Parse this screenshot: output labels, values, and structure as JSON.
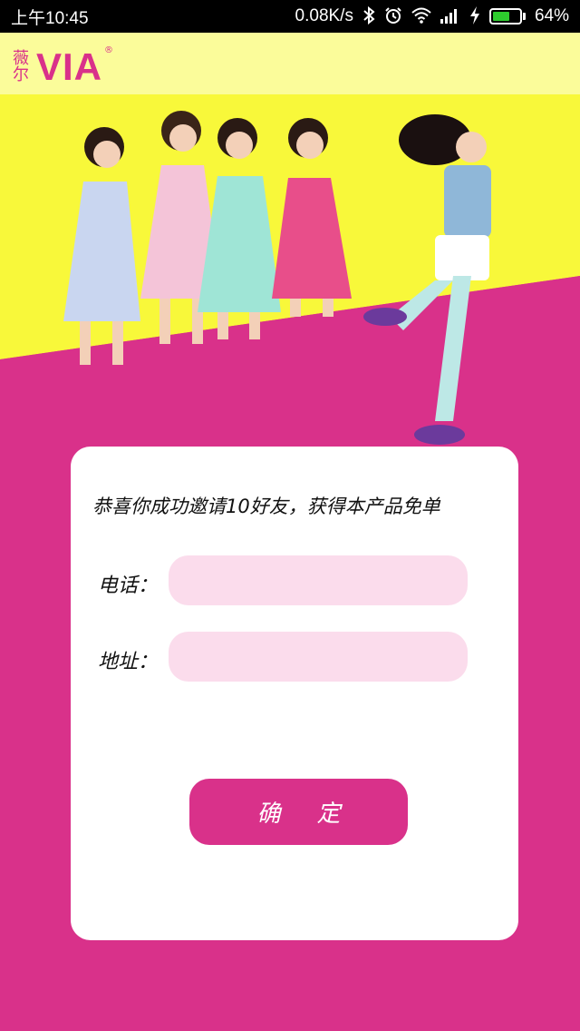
{
  "status_bar": {
    "time": "上午10:45",
    "network_speed": "0.08K/s",
    "battery_percent": "64%",
    "battery_level": 0.64,
    "icons": [
      "bluetooth-icon",
      "alarm-icon",
      "wifi-icon",
      "signal-icon",
      "charging-icon",
      "battery-icon"
    ]
  },
  "brand": {
    "logo_cn": "薇尔",
    "logo_en": "VIA",
    "logo_mark": "®"
  },
  "colors": {
    "primary": "#d9318a",
    "brand_bar": "#fbfc9a",
    "hero_yellow": "#f8f83a",
    "input_bg": "#fbdcec",
    "card_bg": "#ffffff"
  },
  "form": {
    "message": "恭喜你成功邀请10好友，获得本产品免单",
    "phone_label": "电话：",
    "phone_value": "",
    "address_label": "地址：",
    "address_value": "",
    "submit_label": "确定"
  }
}
